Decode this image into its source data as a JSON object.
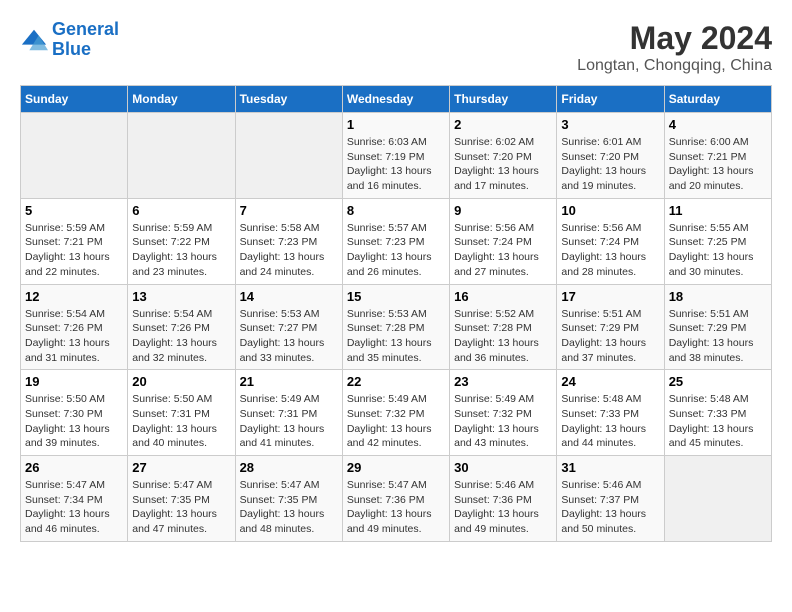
{
  "header": {
    "logo_line1": "General",
    "logo_line2": "Blue",
    "title": "May 2024",
    "subtitle": "Longtan, Chongqing, China"
  },
  "days_of_week": [
    "Sunday",
    "Monday",
    "Tuesday",
    "Wednesday",
    "Thursday",
    "Friday",
    "Saturday"
  ],
  "weeks": [
    [
      {
        "day": "",
        "info": ""
      },
      {
        "day": "",
        "info": ""
      },
      {
        "day": "",
        "info": ""
      },
      {
        "day": "1",
        "info": "Sunrise: 6:03 AM\nSunset: 7:19 PM\nDaylight: 13 hours\nand 16 minutes."
      },
      {
        "day": "2",
        "info": "Sunrise: 6:02 AM\nSunset: 7:20 PM\nDaylight: 13 hours\nand 17 minutes."
      },
      {
        "day": "3",
        "info": "Sunrise: 6:01 AM\nSunset: 7:20 PM\nDaylight: 13 hours\nand 19 minutes."
      },
      {
        "day": "4",
        "info": "Sunrise: 6:00 AM\nSunset: 7:21 PM\nDaylight: 13 hours\nand 20 minutes."
      }
    ],
    [
      {
        "day": "5",
        "info": "Sunrise: 5:59 AM\nSunset: 7:21 PM\nDaylight: 13 hours\nand 22 minutes."
      },
      {
        "day": "6",
        "info": "Sunrise: 5:59 AM\nSunset: 7:22 PM\nDaylight: 13 hours\nand 23 minutes."
      },
      {
        "day": "7",
        "info": "Sunrise: 5:58 AM\nSunset: 7:23 PM\nDaylight: 13 hours\nand 24 minutes."
      },
      {
        "day": "8",
        "info": "Sunrise: 5:57 AM\nSunset: 7:23 PM\nDaylight: 13 hours\nand 26 minutes."
      },
      {
        "day": "9",
        "info": "Sunrise: 5:56 AM\nSunset: 7:24 PM\nDaylight: 13 hours\nand 27 minutes."
      },
      {
        "day": "10",
        "info": "Sunrise: 5:56 AM\nSunset: 7:24 PM\nDaylight: 13 hours\nand 28 minutes."
      },
      {
        "day": "11",
        "info": "Sunrise: 5:55 AM\nSunset: 7:25 PM\nDaylight: 13 hours\nand 30 minutes."
      }
    ],
    [
      {
        "day": "12",
        "info": "Sunrise: 5:54 AM\nSunset: 7:26 PM\nDaylight: 13 hours\nand 31 minutes."
      },
      {
        "day": "13",
        "info": "Sunrise: 5:54 AM\nSunset: 7:26 PM\nDaylight: 13 hours\nand 32 minutes."
      },
      {
        "day": "14",
        "info": "Sunrise: 5:53 AM\nSunset: 7:27 PM\nDaylight: 13 hours\nand 33 minutes."
      },
      {
        "day": "15",
        "info": "Sunrise: 5:53 AM\nSunset: 7:28 PM\nDaylight: 13 hours\nand 35 minutes."
      },
      {
        "day": "16",
        "info": "Sunrise: 5:52 AM\nSunset: 7:28 PM\nDaylight: 13 hours\nand 36 minutes."
      },
      {
        "day": "17",
        "info": "Sunrise: 5:51 AM\nSunset: 7:29 PM\nDaylight: 13 hours\nand 37 minutes."
      },
      {
        "day": "18",
        "info": "Sunrise: 5:51 AM\nSunset: 7:29 PM\nDaylight: 13 hours\nand 38 minutes."
      }
    ],
    [
      {
        "day": "19",
        "info": "Sunrise: 5:50 AM\nSunset: 7:30 PM\nDaylight: 13 hours\nand 39 minutes."
      },
      {
        "day": "20",
        "info": "Sunrise: 5:50 AM\nSunset: 7:31 PM\nDaylight: 13 hours\nand 40 minutes."
      },
      {
        "day": "21",
        "info": "Sunrise: 5:49 AM\nSunset: 7:31 PM\nDaylight: 13 hours\nand 41 minutes."
      },
      {
        "day": "22",
        "info": "Sunrise: 5:49 AM\nSunset: 7:32 PM\nDaylight: 13 hours\nand 42 minutes."
      },
      {
        "day": "23",
        "info": "Sunrise: 5:49 AM\nSunset: 7:32 PM\nDaylight: 13 hours\nand 43 minutes."
      },
      {
        "day": "24",
        "info": "Sunrise: 5:48 AM\nSunset: 7:33 PM\nDaylight: 13 hours\nand 44 minutes."
      },
      {
        "day": "25",
        "info": "Sunrise: 5:48 AM\nSunset: 7:33 PM\nDaylight: 13 hours\nand 45 minutes."
      }
    ],
    [
      {
        "day": "26",
        "info": "Sunrise: 5:47 AM\nSunset: 7:34 PM\nDaylight: 13 hours\nand 46 minutes."
      },
      {
        "day": "27",
        "info": "Sunrise: 5:47 AM\nSunset: 7:35 PM\nDaylight: 13 hours\nand 47 minutes."
      },
      {
        "day": "28",
        "info": "Sunrise: 5:47 AM\nSunset: 7:35 PM\nDaylight: 13 hours\nand 48 minutes."
      },
      {
        "day": "29",
        "info": "Sunrise: 5:47 AM\nSunset: 7:36 PM\nDaylight: 13 hours\nand 49 minutes."
      },
      {
        "day": "30",
        "info": "Sunrise: 5:46 AM\nSunset: 7:36 PM\nDaylight: 13 hours\nand 49 minutes."
      },
      {
        "day": "31",
        "info": "Sunrise: 5:46 AM\nSunset: 7:37 PM\nDaylight: 13 hours\nand 50 minutes."
      },
      {
        "day": "",
        "info": ""
      }
    ]
  ]
}
